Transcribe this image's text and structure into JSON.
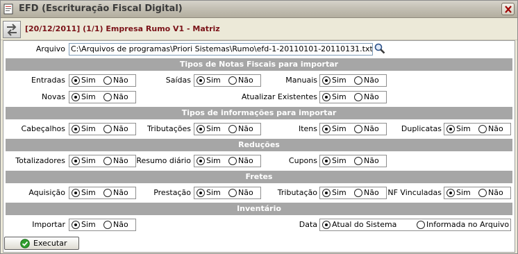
{
  "window": {
    "title": "EFD (Escrituração Fiscal Digital)"
  },
  "toolbar": {
    "context": "[20/12/2011] (1/1) Empresa Rumo V1 - Matriz"
  },
  "arquivo": {
    "label": "Arquivo",
    "value": "C:\\Arquivos de programas\\Priori Sistemas\\Rumo\\efd-1-20110101-20110131.txt"
  },
  "sections": {
    "notas": "Tipos de Notas Fiscais para importar",
    "informacoes": "Tipos de informações para importar",
    "reducoes": "Reduções",
    "fretes": "Fretes",
    "inventario": "Inventário"
  },
  "options": {
    "sim": "Sim",
    "nao": "Não",
    "atual_sistema": "Atual do Sistema",
    "informada_arquivo": "Informada no Arquivo"
  },
  "fields": {
    "entradas": {
      "label": "Entradas",
      "selected": "Sim"
    },
    "saidas": {
      "label": "Saídas",
      "selected": "Sim"
    },
    "manuais": {
      "label": "Manuais",
      "selected": "Sim"
    },
    "novas": {
      "label": "Novas",
      "selected": "Sim"
    },
    "atualizar_existentes": {
      "label": "Atualizar Existentes",
      "selected": "Sim"
    },
    "cabecalhos": {
      "label": "Cabeçalhos",
      "selected": "Sim"
    },
    "tributacoes": {
      "label": "Tributações",
      "selected": "Sim"
    },
    "itens": {
      "label": "Itens",
      "selected": "Sim"
    },
    "duplicatas": {
      "label": "Duplicatas",
      "selected": "Sim"
    },
    "totalizadores": {
      "label": "Totalizadores",
      "selected": "Sim"
    },
    "resumo_diario": {
      "label": "Resumo diário",
      "selected": "Sim"
    },
    "cupons": {
      "label": "Cupons",
      "selected": "Sim"
    },
    "aquisicao": {
      "label": "Aquisição",
      "selected": "Sim"
    },
    "prestacao": {
      "label": "Prestação",
      "selected": "Sim"
    },
    "tributacao": {
      "label": "Tributação",
      "selected": "Sim"
    },
    "nf_vinculadas": {
      "label": "NF Vinculadas",
      "selected": "Sim"
    },
    "importar": {
      "label": "Importar",
      "selected": "Sim"
    },
    "data": {
      "label": "Data",
      "selected": "Atual do Sistema"
    }
  },
  "buttons": {
    "executar": "Executar"
  },
  "icons": {
    "app": "document-icon",
    "close": "close-icon",
    "nav": "swap-arrows-icon",
    "browse": "magnifier-icon",
    "executar": "check-icon"
  },
  "colors": {
    "context_text": "#7a1218",
    "section_bar": "#a6a6a6",
    "check_green": "#2e9e2e"
  }
}
